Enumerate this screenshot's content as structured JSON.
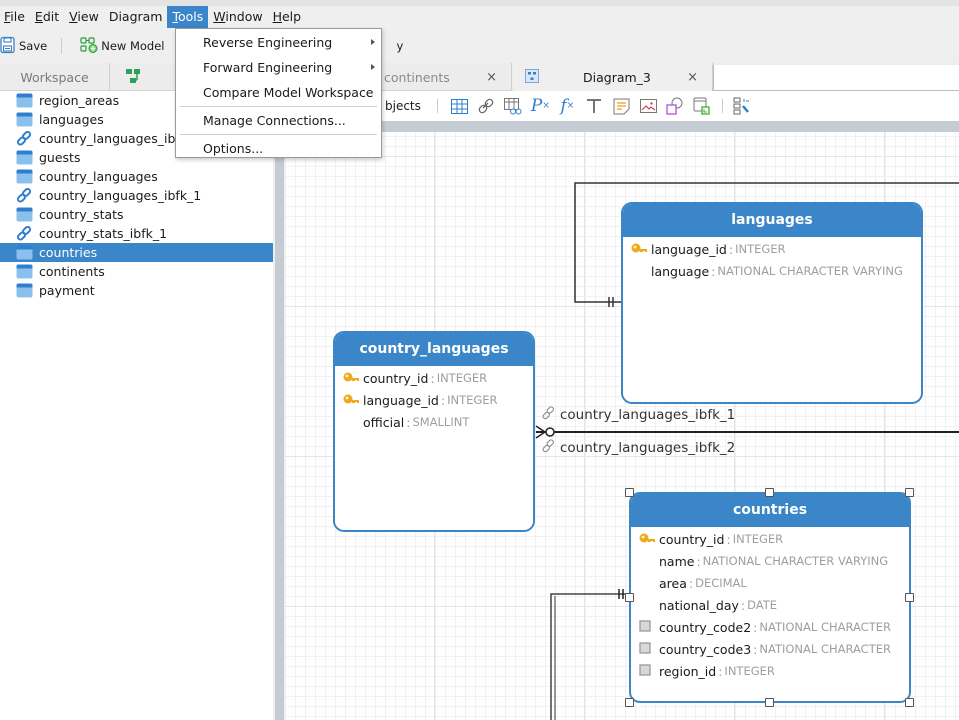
{
  "menubar": {
    "items": [
      {
        "label": "File",
        "mnemonic": "F",
        "rest": "ile"
      },
      {
        "label": "Edit",
        "mnemonic": "E",
        "rest": "dit"
      },
      {
        "label": "View",
        "mnemonic": "V",
        "rest": "iew"
      },
      {
        "label": "Diagram",
        "mnemonic": "",
        "rest": "Diagram"
      },
      {
        "label": "Tools",
        "mnemonic": "T",
        "rest": "ools"
      },
      {
        "label": "Window",
        "mnemonic": "W",
        "rest": "indow"
      },
      {
        "label": "Help",
        "mnemonic": "H",
        "rest": "elp"
      }
    ],
    "active": "Tools"
  },
  "toolbar": {
    "save_label": "Save",
    "new_model_label": "New Model",
    "partial_label": "y"
  },
  "tabs": {
    "workspace_label": "Workspace",
    "continents_label": "continents",
    "diagram_label": "Diagram_3",
    "close_glyph": "×"
  },
  "diagram_toolbar": {
    "objects_label": "bjects"
  },
  "sidebar": {
    "items": [
      {
        "label": "region_areas",
        "icon": "table-icon",
        "selected": false
      },
      {
        "label": "languages",
        "icon": "table-icon",
        "selected": false
      },
      {
        "label": "country_languages_ibfk_2",
        "icon": "link-icon",
        "selected": false
      },
      {
        "label": "guests",
        "icon": "table-icon",
        "selected": false
      },
      {
        "label": "country_languages",
        "icon": "table-icon",
        "selected": false
      },
      {
        "label": "country_languages_ibfk_1",
        "icon": "link-icon",
        "selected": false
      },
      {
        "label": "country_stats",
        "icon": "table-icon",
        "selected": false
      },
      {
        "label": "country_stats_ibfk_1",
        "icon": "link-icon",
        "selected": false
      },
      {
        "label": "countries",
        "icon": "table-icon",
        "selected": true
      },
      {
        "label": "continents",
        "icon": "table-icon",
        "selected": false
      },
      {
        "label": "payment",
        "icon": "table-icon",
        "selected": false
      }
    ]
  },
  "tools_menu": {
    "items": [
      {
        "label": "Reverse Engineering",
        "submenu": true
      },
      {
        "label": "Forward Engineering",
        "submenu": true
      },
      {
        "label": "Compare Model Workspace",
        "submenu": false
      },
      {
        "label": "Manage Connections...",
        "submenu": false
      },
      {
        "label": "Options...",
        "submenu": false
      }
    ]
  },
  "entities": {
    "languages": {
      "name": "languages",
      "columns": [
        {
          "name": "language_id",
          "type": "INTEGER",
          "key": "primary"
        },
        {
          "name": "language",
          "type": "NATIONAL CHARACTER VARYING",
          "key": "none"
        }
      ]
    },
    "country_languages": {
      "name": "country_languages",
      "columns": [
        {
          "name": "country_id",
          "type": "INTEGER",
          "key": "primary"
        },
        {
          "name": "language_id",
          "type": "INTEGER",
          "key": "primary"
        },
        {
          "name": "official",
          "type": "SMALLINT",
          "key": "none"
        }
      ]
    },
    "countries": {
      "name": "countries",
      "columns": [
        {
          "name": "country_id",
          "type": "INTEGER",
          "key": "primary"
        },
        {
          "name": "name",
          "type": "NATIONAL CHARACTER VARYING",
          "key": "none"
        },
        {
          "name": "area",
          "type": "DECIMAL",
          "key": "none"
        },
        {
          "name": "national_day",
          "type": "DATE",
          "key": "none"
        },
        {
          "name": "country_code2",
          "type": "NATIONAL CHARACTER",
          "key": "index"
        },
        {
          "name": "country_code3",
          "type": "NATIONAL CHARACTER",
          "key": "index"
        },
        {
          "name": "region_id",
          "type": "INTEGER",
          "key": "index"
        }
      ]
    }
  },
  "relationships": [
    {
      "label": "country_languages_ibfk_1"
    },
    {
      "label": "country_languages_ibfk_2"
    }
  ],
  "colors": {
    "accent": "#3a86c8",
    "type_text": "#9e9e9e",
    "key_gold": "#f0a81e"
  }
}
